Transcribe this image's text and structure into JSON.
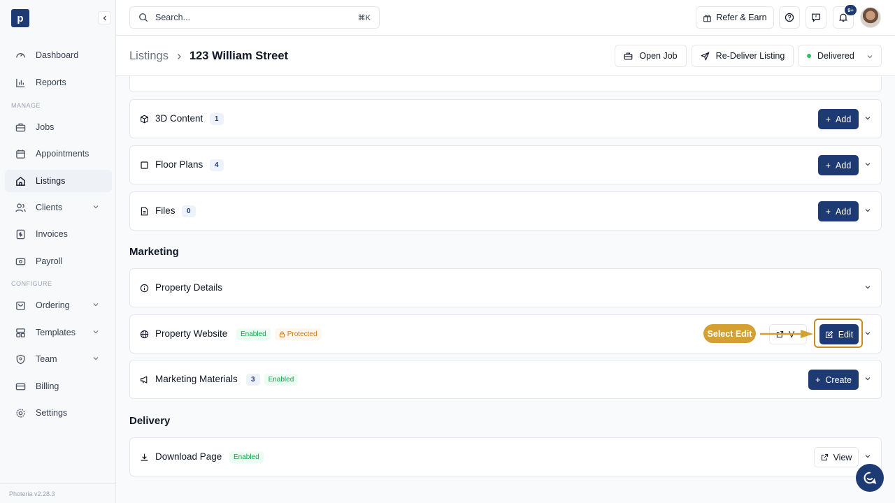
{
  "sidebar": {
    "logo_letter": "p",
    "manage_label": "MANAGE",
    "configure_label": "CONFIGURE",
    "version": "Photeria v2.28.3",
    "items": [
      {
        "label": "Dashboard",
        "icon": "gauge-icon"
      },
      {
        "label": "Reports",
        "icon": "bar-chart-icon"
      },
      {
        "label": "Jobs",
        "icon": "briefcase-icon"
      },
      {
        "label": "Appointments",
        "icon": "calendar-icon"
      },
      {
        "label": "Listings",
        "icon": "home-icon",
        "active": true
      },
      {
        "label": "Clients",
        "icon": "users-icon"
      },
      {
        "label": "Invoices",
        "icon": "invoice-icon"
      },
      {
        "label": "Payroll",
        "icon": "payroll-icon"
      },
      {
        "label": "Ordering",
        "icon": "bag-icon"
      },
      {
        "label": "Templates",
        "icon": "layout-icon"
      },
      {
        "label": "Team",
        "icon": "shield-icon"
      },
      {
        "label": "Billing",
        "icon": "card-icon"
      },
      {
        "label": "Settings",
        "icon": "gear-icon"
      }
    ]
  },
  "topbar": {
    "search_placeholder": "Search...",
    "search_shortcut": "⌘K",
    "refer_label": "Refer & Earn",
    "notification_count": "9+"
  },
  "header": {
    "breadcrumb_parent": "Listings",
    "breadcrumb_current": "123 William Street",
    "open_job": "Open Job",
    "redeliver": "Re-Deliver Listing",
    "status": "Delivered",
    "status_color": "#22c55e"
  },
  "content": {
    "threed": {
      "title": "3D Content",
      "count": "1",
      "button": "Add"
    },
    "floorplans": {
      "title": "Floor Plans",
      "count": "4",
      "button": "Add"
    },
    "files": {
      "title": "Files",
      "count": "0",
      "button": "Add"
    },
    "marketing_heading": "Marketing",
    "property_details": {
      "title": "Property Details"
    },
    "property_website": {
      "title": "Property Website",
      "tag_enabled": "Enabled",
      "tag_protected": "Protected",
      "view_partial": "V",
      "button": "Edit"
    },
    "marketing_materials": {
      "title": "Marketing Materials",
      "count": "3",
      "tag_enabled": "Enabled",
      "button": "Create"
    },
    "delivery_heading": "Delivery",
    "download_page": {
      "title": "Download Page",
      "tag_enabled": "Enabled",
      "button": "View"
    }
  },
  "annotation": {
    "callout": "Select Edit",
    "color": "#d4a031"
  },
  "colors": {
    "primary": "#1e3a73",
    "enabled_green": "#16a34a",
    "protected_orange": "#d97706"
  }
}
